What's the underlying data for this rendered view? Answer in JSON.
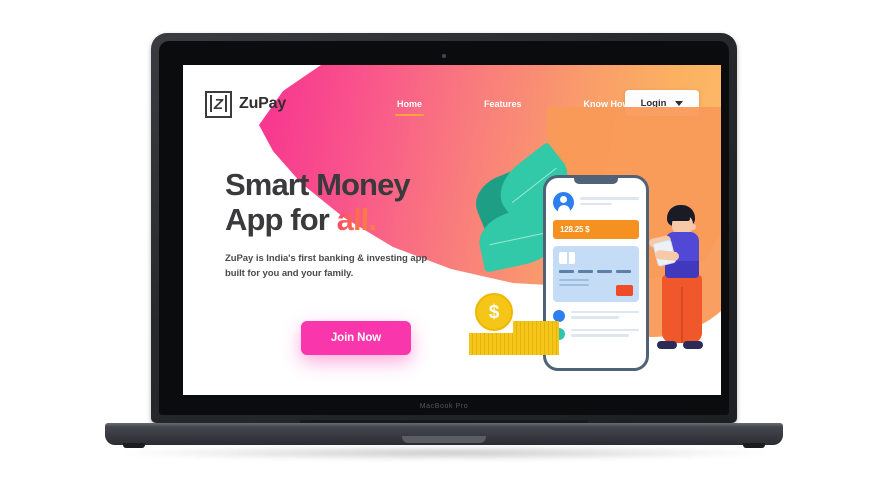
{
  "device": {
    "model_label": "MacBook Pro"
  },
  "site": {
    "brand": {
      "logo_glyph": "Z",
      "name": "ZuPay"
    },
    "nav": {
      "items": [
        {
          "label": "Home",
          "active": true
        },
        {
          "label": "Features",
          "active": false
        },
        {
          "label": "Know How's",
          "active": false
        }
      ],
      "login": {
        "label": "Login",
        "caret_icon": "chevron-down-icon"
      }
    },
    "hero": {
      "headline_line1": "Smart Money",
      "headline_line2_plain": "App for ",
      "headline_line2_accent": "all.",
      "subtext_line1": "ZuPay is India's first banking & investing app",
      "subtext_line2": "built for you and your family.",
      "cta_label": "Join Now"
    },
    "illustration": {
      "phone": {
        "balance_amount": "128.25 $",
        "avatar_icon": "user-avatar-icon",
        "card_label": "credit-card",
        "action_button": "card-action-button"
      },
      "coin_symbol": "$",
      "character": "person-with-tablet",
      "leaves": "plant-leaves"
    }
  },
  "colors": {
    "gradient_pink": "#f8218f",
    "gradient_orange": "#fcbd68",
    "accent_orange": "#f7a53c",
    "cta_pink": "#fa36ac",
    "balance_orange": "#f59120",
    "headline_dark": "#3a3a3c",
    "blue": "#2d7ff0",
    "teal": "#2fc5ac",
    "coin_gold": "#f5c518",
    "pants_orange": "#f0572a",
    "shirt_blue": "#5148d6",
    "laptop_gray": "#3b3e44"
  }
}
